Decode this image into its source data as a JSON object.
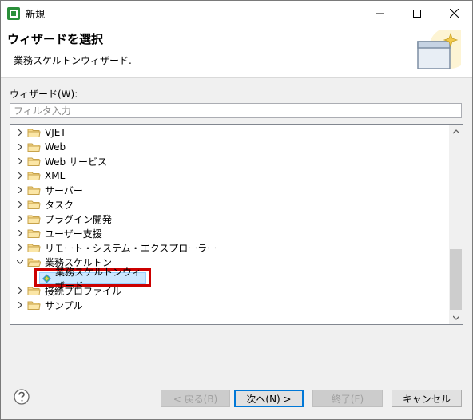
{
  "window": {
    "title": "新規",
    "controls": {
      "minimize": "minimize",
      "maximize": "maximize",
      "close": "close"
    }
  },
  "banner": {
    "title": "ウィザードを選択",
    "description": "業務スケルトンウィザード."
  },
  "wizards_label": "ウィザード(W):",
  "filter": {
    "placeholder": "フィルタ入力",
    "value": ""
  },
  "tree": {
    "items": [
      {
        "label": "VJET",
        "expanded": false
      },
      {
        "label": "Web",
        "expanded": false
      },
      {
        "label": "Web サービス",
        "expanded": false
      },
      {
        "label": "XML",
        "expanded": false
      },
      {
        "label": "サーバー",
        "expanded": false
      },
      {
        "label": "タスク",
        "expanded": false
      },
      {
        "label": "プラグイン開発",
        "expanded": false
      },
      {
        "label": "ユーザー支援",
        "expanded": false
      },
      {
        "label": "リモート・システム・エクスプローラー",
        "expanded": false
      },
      {
        "label": "業務スケルトン",
        "expanded": true
      },
      {
        "label": "接続プロファイル",
        "expanded": false
      },
      {
        "label": "サンプル",
        "expanded": false
      }
    ],
    "selected_child": "業務スケルトンウィザード"
  },
  "buttons": {
    "back": "< 戻る(B)",
    "next": "次へ(N) >",
    "finish": "終了(F)",
    "cancel": "キャンセル"
  },
  "colors": {
    "highlight_border": "#cc0000",
    "selection_bg": "#cce8ff"
  }
}
